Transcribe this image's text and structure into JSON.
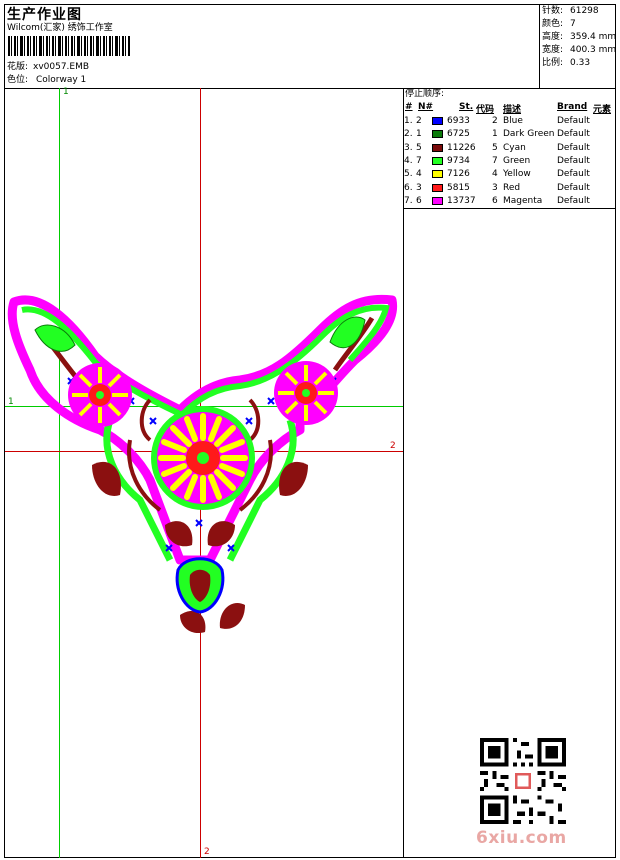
{
  "header": {
    "title": "生产作业图",
    "subtitle": "Wilcom(汇家) 绣饰工作室",
    "design_label": "花版:",
    "design_value": "xv0057.EMB",
    "color_label": "色位:",
    "color_value": "Colorway 1"
  },
  "stats": {
    "stitches_label": "针数:",
    "stitches_value": "61298",
    "colors_label": "颜色:",
    "colors_value": "7",
    "height_label": "高度:",
    "height_value": "359.4 mm",
    "width_label": "宽度:",
    "width_value": "400.3 mm",
    "scale_label": "比例:",
    "scale_value": "0.33"
  },
  "stop_sequence": {
    "heading": "停止顺序:",
    "columns": [
      "#",
      "N#",
      "St.",
      "代码",
      "描述",
      "Brand",
      "元素"
    ],
    "rows": [
      {
        "seq": "1.",
        "n": "2",
        "color": "#0000ff",
        "stitches": "6933",
        "code": "2",
        "desc": "Blue",
        "brand": "Default"
      },
      {
        "seq": "2.",
        "n": "1",
        "color": "#0a7a0a",
        "stitches": "6725",
        "code": "1",
        "desc": "Dark Green",
        "brand": "Default"
      },
      {
        "seq": "3.",
        "n": "5",
        "color": "#7a0a0a",
        "stitches": "11226",
        "code": "5",
        "desc": "Cyan",
        "brand": "Default"
      },
      {
        "seq": "4.",
        "n": "7",
        "color": "#22ff22",
        "stitches": "9734",
        "code": "7",
        "desc": "Green",
        "brand": "Default"
      },
      {
        "seq": "5.",
        "n": "4",
        "color": "#ffff00",
        "stitches": "7126",
        "code": "4",
        "desc": "Yellow",
        "brand": "Default"
      },
      {
        "seq": "6.",
        "n": "3",
        "color": "#ff1a1a",
        "stitches": "5815",
        "code": "3",
        "desc": "Red",
        "brand": "Default"
      },
      {
        "seq": "7.",
        "n": "6",
        "color": "#ff00ff",
        "stitches": "13737",
        "code": "6",
        "desc": "Magenta",
        "brand": "Default"
      }
    ]
  },
  "guides": {
    "green_v_label": "1",
    "green_h_label": "1",
    "red_h_label": "2",
    "red_v_label": "2"
  },
  "watermark": "6xiu.com",
  "colors": {
    "magenta": "#ff00ff",
    "green": "#22ff22",
    "yellow": "#ffff00",
    "red": "#ff1a1a",
    "dark_red": "#8b1010",
    "blue": "#0000ff",
    "guide_green": "#00cc00",
    "guide_red": "#cc0000"
  }
}
